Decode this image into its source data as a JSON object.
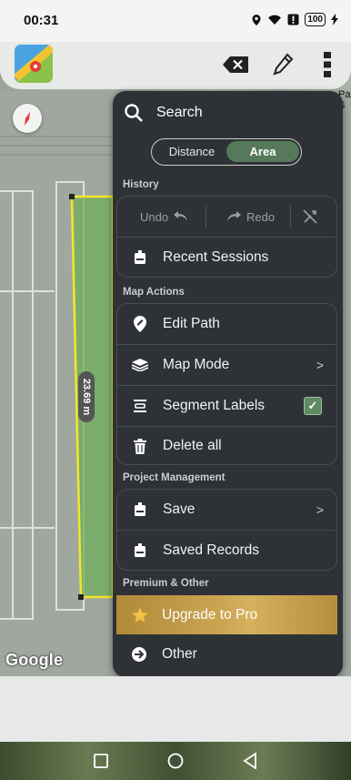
{
  "status_bar": {
    "time": "00:31",
    "battery": "100"
  },
  "map": {
    "measurement_label": "23.69 m",
    "attribution": "Google",
    "partial_label": "Pa\nS"
  },
  "menu": {
    "search_label": "Search",
    "mode_toggle": {
      "options": [
        "Distance",
        "Area"
      ],
      "selected": "Area"
    },
    "sections": {
      "history": {
        "title": "History",
        "undo_label": "Undo",
        "redo_label": "Redo",
        "recent_sessions_label": "Recent Sessions"
      },
      "map_actions": {
        "title": "Map Actions",
        "items": [
          {
            "label": "Edit Path",
            "icon": "edit-path-icon"
          },
          {
            "label": "Map Mode",
            "icon": "layers-icon",
            "chevron": ">"
          },
          {
            "label": "Segment Labels",
            "icon": "segment-labels-icon",
            "checked": true
          },
          {
            "label": "Delete all",
            "icon": "trash-icon"
          }
        ]
      },
      "project_management": {
        "title": "Project Management",
        "items": [
          {
            "label": "Save",
            "icon": "save-icon",
            "chevron": ">"
          },
          {
            "label": "Saved Records",
            "icon": "saved-records-icon"
          }
        ]
      },
      "premium": {
        "title": "Premium & Other",
        "upgrade_label": "Upgrade to Pro",
        "other_label": "Other"
      }
    }
  },
  "colors": {
    "menu_bg": "#2e3236",
    "accent_green": "#55795a",
    "gold": "#c9a34f",
    "polygon_stroke": "#f2e62b",
    "polygon_fill": "#6fae5a"
  }
}
